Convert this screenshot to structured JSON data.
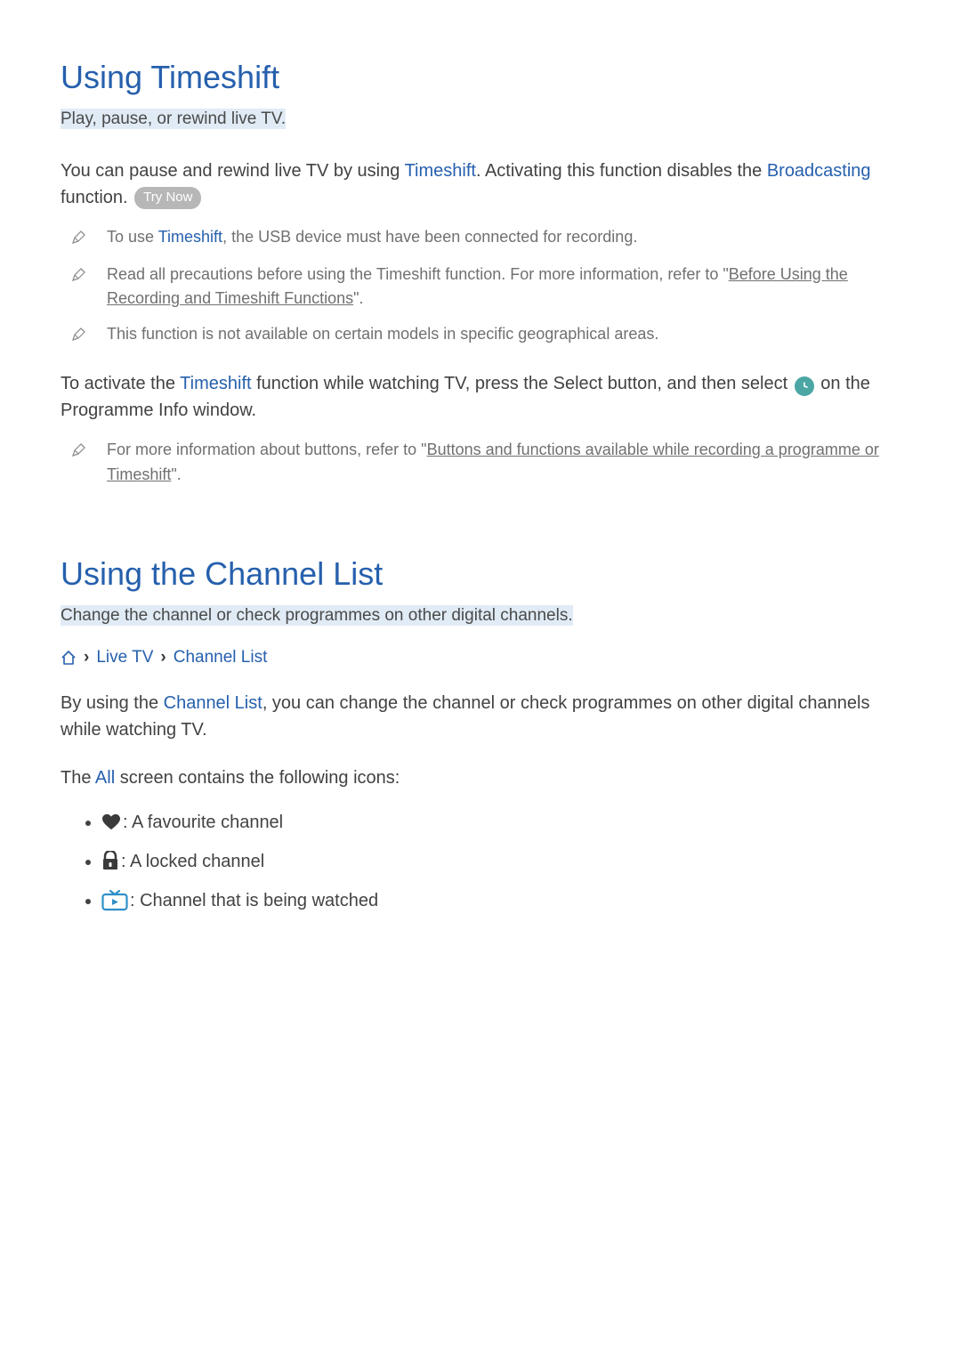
{
  "section1": {
    "heading": "Using Timeshift",
    "subtitle": "Play, pause, or rewind live TV.",
    "para_pre": "You can pause and rewind live TV by using ",
    "para_feature": "Timeshift",
    "para_mid": ". Activating this function disables the ",
    "para_broadcasting": "Broadcasting",
    "para_post": " function. ",
    "try_now": "Try Now",
    "notes": {
      "n1_pre": "To use ",
      "n1_feature": "Timeshift",
      "n1_post": ", the USB device must have been connected for recording.",
      "n2_pre": "Read all precautions before using the Timeshift function. For more information, refer to \"",
      "n2_link": "Before Using the Recording and Timeshift Functions",
      "n2_post": "\".",
      "n3": "This function is not available on certain models in specific geographical areas."
    },
    "activate_pre": "To activate the ",
    "activate_feature": "Timeshift",
    "activate_mid": " function while watching TV, press the Select button, and then select ",
    "activate_post": " on the Programme Info window.",
    "note4_pre": "For more information about buttons, refer to \"",
    "note4_link": "Buttons and functions available while recording a programme or Timeshift",
    "note4_post": "\"."
  },
  "section2": {
    "heading": "Using the Channel List",
    "subtitle": "Change the channel or check programmes on other digital channels.",
    "breadcrumb": {
      "live_tv": "Live TV",
      "channel_list": "Channel List"
    },
    "para_pre": "By using the ",
    "para_feature": "Channel List",
    "para_post": ", you can change the channel or check programmes on other digital channels while watching TV.",
    "all_pre": "The ",
    "all_word": "All",
    "all_post": " screen contains the following icons:",
    "icons": {
      "fav": ": A favourite channel",
      "lock": ": A locked channel",
      "watch": ": Channel that is being watched"
    }
  }
}
